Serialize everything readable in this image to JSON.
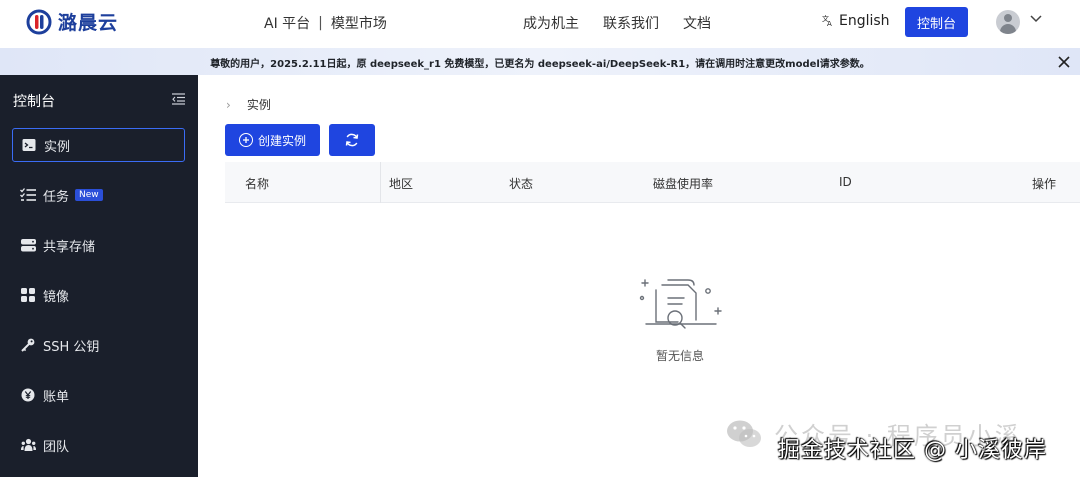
{
  "header": {
    "brand": "潞晨云",
    "nav_left": {
      "platform": "AI 平台",
      "separator": "|",
      "market": "模型市场"
    },
    "nav_right": [
      {
        "label": "成为机主"
      },
      {
        "label": "联系我们"
      },
      {
        "label": "文档"
      }
    ],
    "language": "English",
    "language_icon": "translate-icon",
    "console_button": "控制台"
  },
  "notice": {
    "text": "尊敬的用户，2025.2.11日起，原 deepseek_r1 免费模型，已更名为 deepseek-ai/DeepSeek-R1，请在调用时注意更改model请求参数。"
  },
  "sidebar": {
    "title": "控制台",
    "items": [
      {
        "label": "实例",
        "icon": "terminal-icon",
        "active": true
      },
      {
        "label": "任务",
        "icon": "task-list-icon",
        "badge": "New"
      },
      {
        "label": "共享存储",
        "icon": "storage-icon"
      },
      {
        "label": "镜像",
        "icon": "image-grid-icon"
      },
      {
        "label": "SSH 公钥",
        "icon": "key-icon"
      },
      {
        "label": "账单",
        "icon": "yen-icon"
      },
      {
        "label": "团队",
        "icon": "team-icon"
      }
    ]
  },
  "main": {
    "breadcrumb": "实例",
    "create_button": "创建实例",
    "table": {
      "columns": [
        "名称",
        "地区",
        "状态",
        "磁盘使用率",
        "ID",
        "操作"
      ],
      "rows": []
    },
    "empty_text": "暂无信息"
  },
  "watermark": {
    "line1": "公众号 · 程序员小溪",
    "line2": "掘金技术社区 @ 小溪彼岸"
  },
  "colors": {
    "primary": "#1f45e0",
    "sidebar_bg": "#1a1f2b",
    "brand_blue": "#1d3f9c",
    "brand_red": "#d9232a"
  }
}
